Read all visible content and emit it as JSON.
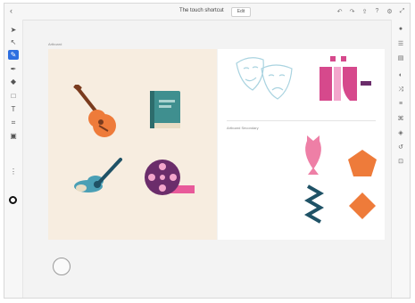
{
  "app": {
    "back_icon": "chevron-left-icon",
    "title": "The touch shortcut",
    "edit_label": "Edit",
    "top_icons": [
      "undo-icon",
      "redo-icon",
      "share-icon",
      "help-icon",
      "settings-icon",
      "fullscreen-icon"
    ]
  },
  "toolbar": {
    "tools": [
      "select-tool-icon",
      "direct-select-tool-icon",
      "pencil-tool-icon",
      "brush-tool-icon",
      "eraser-tool-icon",
      "shape-tool-icon",
      "type-tool-icon",
      "crop-tool-icon",
      "image-tool-icon",
      "more-tools-icon"
    ]
  },
  "right_panel": {
    "tools": [
      "layers-icon",
      "properties-icon",
      "libraries-icon",
      "path-icon",
      "transform-icon",
      "align-icon",
      "glyphs-icon",
      "color-icon",
      "history-icon",
      "export-icon"
    ]
  },
  "artboards": [
    {
      "label": "Artboard"
    },
    {
      "label": "Artboard Secondary"
    }
  ],
  "colors": {
    "accent": "#2d6fe0",
    "artboard1_bg": "#f7ede0",
    "orange": "#ee7b3a",
    "teal": "#3f8f8f",
    "pink": "#d6498c",
    "purple": "#6b2d6b",
    "navy": "#1f5266"
  }
}
